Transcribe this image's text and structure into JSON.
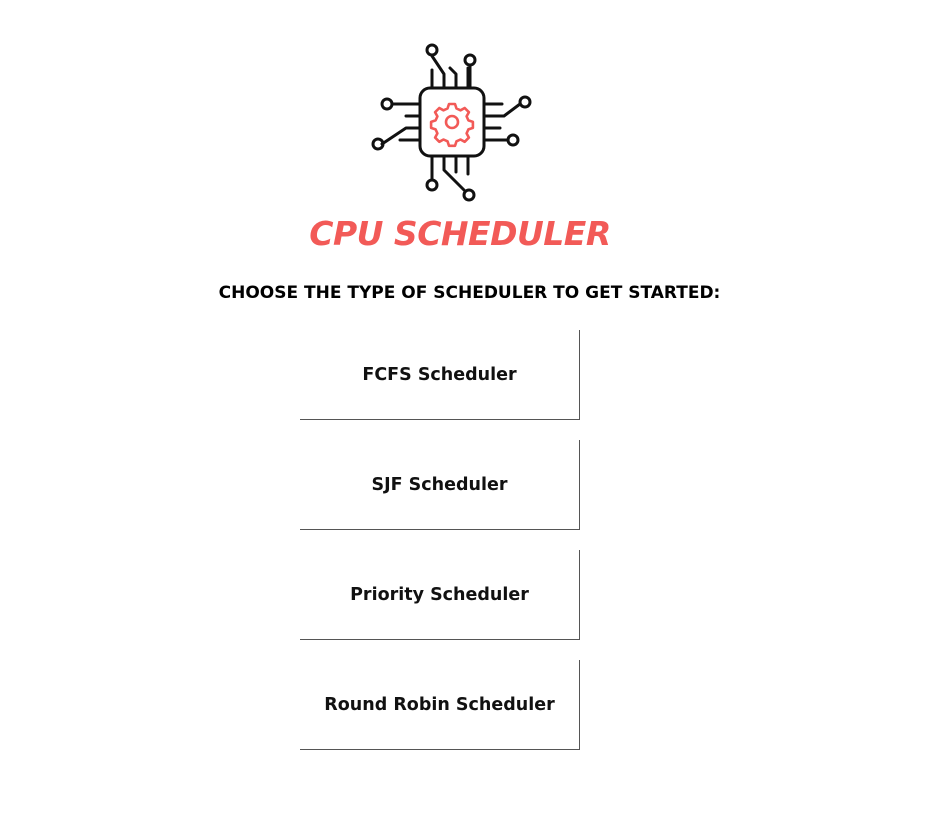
{
  "header": {
    "logo_icon": "cpu-chip-gear-icon",
    "title": "CPU SCHEDULER",
    "subtitle": "CHOOSE THE TYPE OF SCHEDULER TO GET STARTED:"
  },
  "colors": {
    "accent": "#f25a57",
    "text": "#000000",
    "background": "#ffffff"
  },
  "schedulers": [
    {
      "label": "FCFS Scheduler"
    },
    {
      "label": "SJF Scheduler"
    },
    {
      "label": "Priority Scheduler"
    },
    {
      "label": "Round Robin Scheduler"
    }
  ]
}
